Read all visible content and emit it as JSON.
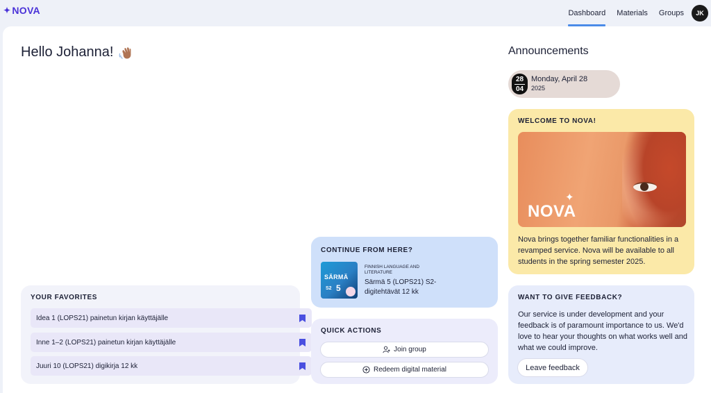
{
  "app": {
    "logo": "NOVA",
    "logo_icon": "sparkle-icon"
  },
  "nav": {
    "items": [
      {
        "label": "Dashboard",
        "active": true
      },
      {
        "label": "Materials",
        "active": false
      },
      {
        "label": "Groups",
        "active": false
      }
    ],
    "avatar_initials": "JK"
  },
  "greeting": {
    "text": "Hello Johanna!",
    "emoji": "waving-hand-icon"
  },
  "favorites": {
    "title": "YOUR FAVORITES",
    "items": [
      {
        "label": "Idea 1 (LOPS21) painetun kirjan käyttäjälle",
        "icon": "bookmark-icon"
      },
      {
        "label": "Inne 1–2 (LOPS21) painetun kirjan käyttäjälle",
        "icon": "bookmark-icon"
      },
      {
        "label": "Juuri 10 (LOPS21) digikirja 12 kk",
        "icon": "bookmark-icon"
      }
    ]
  },
  "continue": {
    "title": "CONTINUE FROM HERE?",
    "book_cover": {
      "title": "SÄRMÄ",
      "tag": "S2",
      "number": "5"
    },
    "subject": "FINNISH LANGUAGE AND LITERATURE",
    "material": "Särmä 5 (LOPS21) S2-digitehtävät 12 kk"
  },
  "quick_actions": {
    "title": "QUICK ACTIONS",
    "buttons": [
      {
        "label": "Join group",
        "icon": "user-plus-icon"
      },
      {
        "label": "Redeem digital material",
        "icon": "plus-circle-icon"
      }
    ]
  },
  "announcements": {
    "title": "Announcements",
    "date": {
      "day": "28",
      "month": "04",
      "label": "Monday, April 28",
      "year": "2025"
    },
    "welcome": {
      "title": "WELCOME TO NOVA!",
      "image_brand": "NOVA",
      "text": "Nova brings together familiar functionalities in a revamped service. Nova will be available to all students in the spring semester 2025."
    },
    "feedback": {
      "title": "WANT TO GIVE FEEDBACK?",
      "text": "Our service is under development and your feedback is of paramount importance to us. We'd love to hear your thoughts on what works well and what we could improve.",
      "button": "Leave feedback"
    }
  },
  "colors": {
    "brand": "#4a32d8",
    "active_tab": "#4a8be8",
    "welcome_card": "#fbe9a8",
    "continue_card": "#cfe0fa"
  }
}
